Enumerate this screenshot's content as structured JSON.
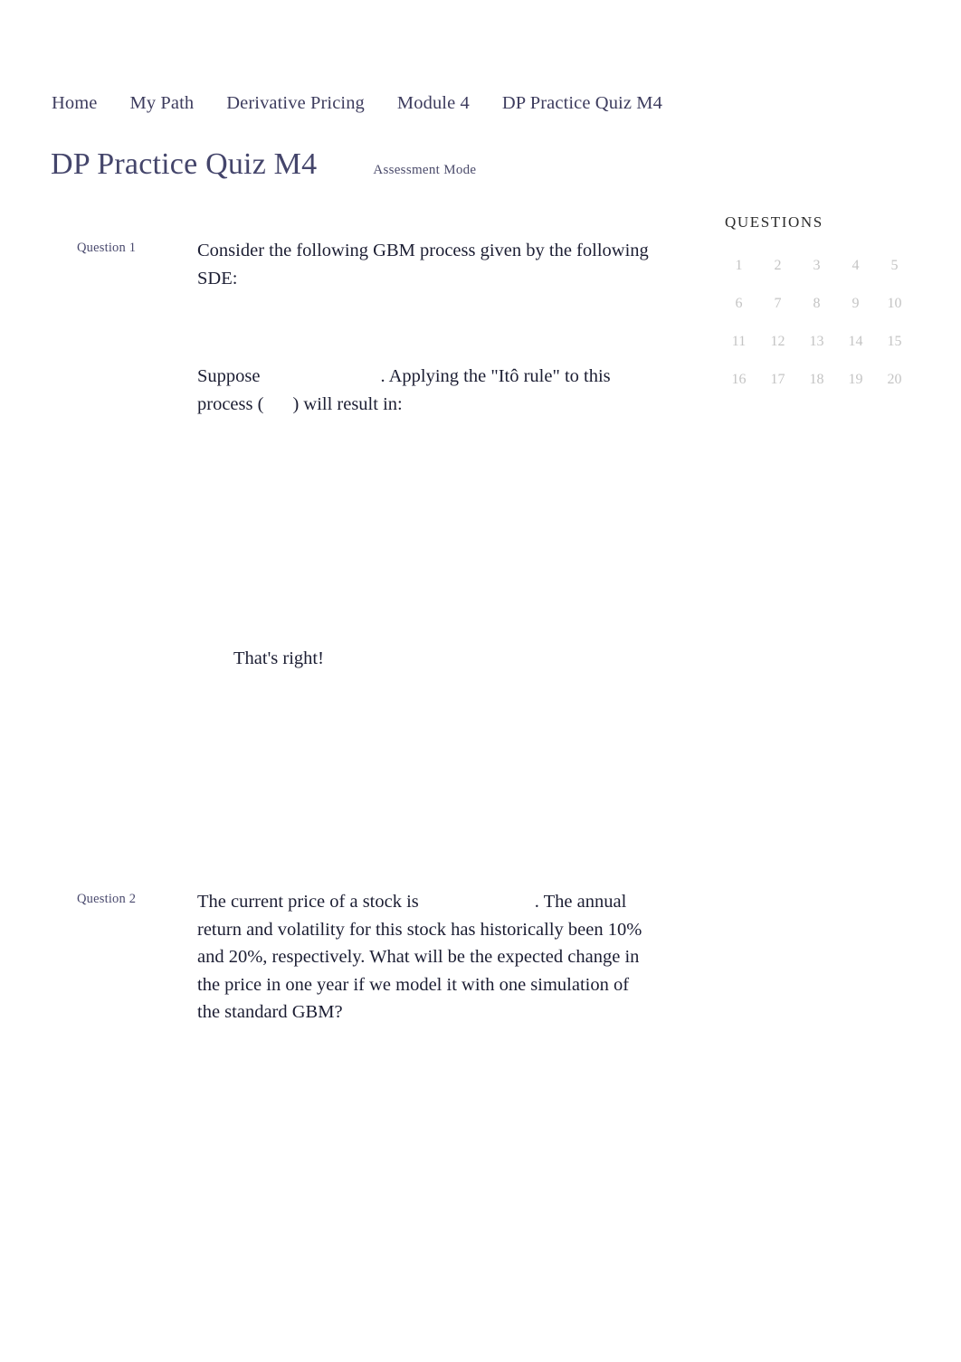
{
  "breadcrumb": {
    "items": [
      {
        "label": "Home"
      },
      {
        "label": "My Path"
      },
      {
        "label": "Derivative Pricing"
      },
      {
        "label": "Module 4"
      },
      {
        "label": "DP Practice Quiz M4"
      }
    ]
  },
  "header": {
    "title": "DP Practice Quiz M4",
    "mode_badge": "Assessment Mode"
  },
  "questions_panel": {
    "title": "QUESTIONS",
    "numbers": [
      "1",
      "2",
      "3",
      "4",
      "5",
      "6",
      "7",
      "8",
      "9",
      "10",
      "11",
      "12",
      "13",
      "14",
      "15",
      "16",
      "17",
      "18",
      "19",
      "20"
    ]
  },
  "questions": [
    {
      "label": "Question 1",
      "text_part_1": "Consider the following GBM process given by the following SDE:",
      "text_part_2_a": "Suppose",
      "text_part_2_b": ". Applying the \"Itô rule\" to this process (",
      "text_part_2_c": ") will result in:",
      "feedback": "That's right!",
      "choices": [
        "",
        "",
        "",
        ""
      ]
    },
    {
      "label": "Question 2",
      "text_part_1": "The current price of a stock is",
      "text_part_2": ". The annual return and volatility for this stock has historically been 10% and 20%, respectively. What will be the expected change in the price in one year if we model it with one simulation of the standard GBM?",
      "choices": [
        "",
        "",
        "",
        ""
      ]
    }
  ],
  "colors": {
    "breadcrumb_text": "#3d3c5e",
    "page_title": "#44456b",
    "body_text": "#1c1e33",
    "question_label": "#4a4a6e",
    "panel_title": "#2a2a2a",
    "panel_number": "#c4c4c4",
    "background": "#ffffff"
  }
}
